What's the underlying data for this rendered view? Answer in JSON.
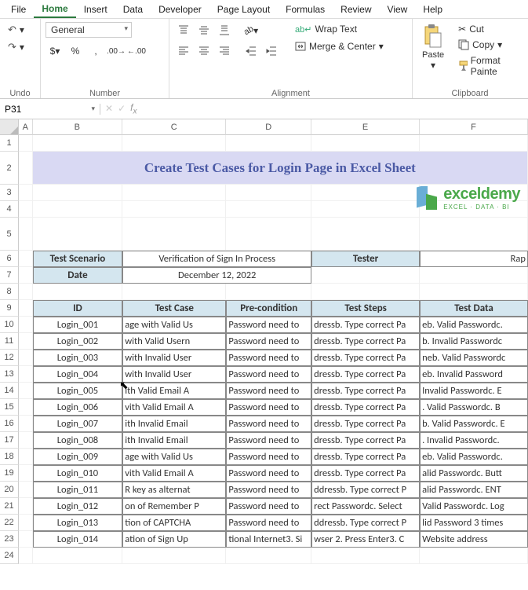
{
  "menu": {
    "items": [
      "File",
      "Home",
      "Insert",
      "Data",
      "Developer",
      "Page Layout",
      "Formulas",
      "Review",
      "View",
      "Help"
    ],
    "active": 1
  },
  "ribbon": {
    "undo": {
      "label": "Undo"
    },
    "number": {
      "label": "Number",
      "format": "General"
    },
    "alignment": {
      "label": "Alignment",
      "wrap": "Wrap Text",
      "merge": "Merge & Center"
    },
    "clipboard": {
      "label": "Clipboard",
      "paste": "Paste",
      "cut": "Cut",
      "copy": "Copy",
      "fp": "Format Painte"
    }
  },
  "namebox": "P31",
  "cols": [
    "A",
    "B",
    "C",
    "D",
    "E",
    "F"
  ],
  "rows": [
    "1",
    "2",
    "3",
    "4",
    "5",
    "6",
    "7",
    "8",
    "9",
    "10",
    "11",
    "12",
    "13",
    "14",
    "15",
    "16",
    "17",
    "18",
    "19",
    "20",
    "21",
    "22",
    "23",
    "24"
  ],
  "sheet": {
    "title": "Create Test Cases for Login Page in Excel Sheet",
    "logo": {
      "main": "exceldemy",
      "sub": "EXCEL · DATA · BI"
    },
    "meta": {
      "scenario_label": "Test Scenario",
      "scenario_val": "Verification of Sign In Process",
      "tester_label": "Tester",
      "tester_val": "Rap",
      "date_label": "Date",
      "date_val": "December 12, 2022"
    },
    "headers": [
      "ID",
      "Test Case",
      "Pre-condition",
      "Test Steps",
      "Test Data"
    ],
    "data": [
      [
        "Login_001",
        "age with Valid Us",
        "Password need to",
        "dressb. Type correct Pa",
        "eb. Valid Passwordc."
      ],
      [
        "Login_002",
        "with Valid Usern",
        "Password need to",
        "dressb. Type correct Pa",
        "b. Invalid Passwordc"
      ],
      [
        "Login_003",
        "with Invalid User",
        "Password need to",
        "dressb. Type correct Pa",
        "neb. Valid Passwordc"
      ],
      [
        "Login_004",
        "with Invalid User",
        "Password need to",
        "dressb. Type correct Pa",
        "eb. Invalid Password"
      ],
      [
        "Login_005",
        "ith Valid Email A",
        "Password need to",
        "dressb. Type correct Pa",
        "Invalid Passwordc. E"
      ],
      [
        "Login_006",
        "vith Valid Email A",
        "Password need to",
        "dressb. Type correct Pa",
        ". Valid Passwordc. B"
      ],
      [
        "Login_007",
        "ith Invalid Email",
        "Password need to",
        "dressb. Type correct Pa",
        "b. Valid Passwordc. E"
      ],
      [
        "Login_008",
        "ith Invalid Email",
        "Password need to",
        "dressb. Type correct Pa",
        ". Invalid Passwordc."
      ],
      [
        "Login_009",
        "age with Valid Us",
        "Password need to",
        "dressb. Type correct Pa",
        "eb. Valid Passwordc."
      ],
      [
        "Login_010",
        "vith Valid Email A",
        "Password need to",
        "dressb. Type correct Pa",
        "alid Passwordc. Butt"
      ],
      [
        "Login_011",
        "R key as alternat",
        "Password need to",
        "ddressb. Type correct P",
        "alid Passwordc. ENT"
      ],
      [
        "Login_012",
        "on of Remember P",
        "Password need to",
        "rect Passwordc. Select",
        "Valid Passwordc. Log"
      ],
      [
        "Login_013",
        "tion of CAPTCHA",
        "Password need to",
        "ddressb. Type correct P",
        "lid Password 3 times"
      ],
      [
        "Login_014",
        "ation of Sign Up",
        "tional Internet3. Si",
        "wser 2. Press Enter3. C",
        "Website address"
      ]
    ]
  }
}
